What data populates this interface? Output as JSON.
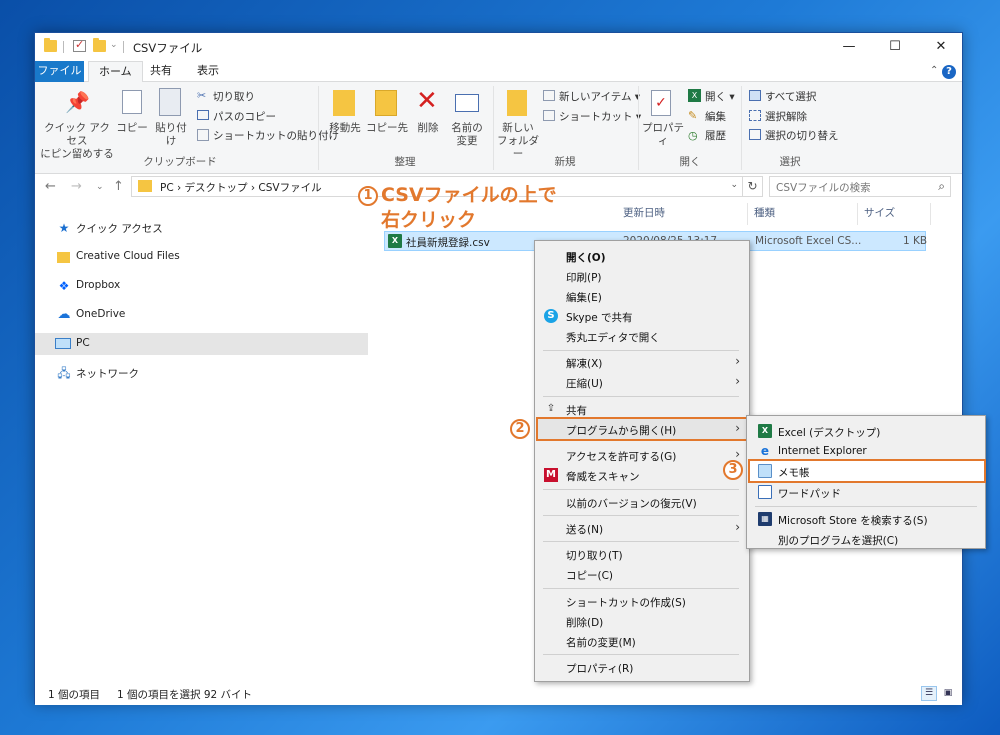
{
  "window": {
    "title": "CSVファイル",
    "minimize": "—",
    "maximize": "☐",
    "close": "✕"
  },
  "ribbon_tabs": [
    "ファイル",
    "ホーム",
    "共有",
    "表示"
  ],
  "ribbon": {
    "clipboard": {
      "label": "クリップボード",
      "pin": "クイック アクセス\nにピン留めする",
      "pin_l1": "クイック アクセス",
      "pin_l2": "にピン留めする",
      "copy": "コピー",
      "paste": "貼り付け",
      "cut": "切り取り",
      "copy_path": "パスのコピー",
      "paste_shortcut": "ショートカットの貼り付け"
    },
    "organize": {
      "label": "整理",
      "move_to": "移動先",
      "copy_to": "コピー先",
      "delete": "削除",
      "rename_l1": "名前の",
      "rename_l2": "変更"
    },
    "new": {
      "label": "新規",
      "new_folder_l1": "新しい",
      "new_folder_l2": "フォルダー",
      "new_item": "新しいアイテム",
      "shortcut": "ショートカット"
    },
    "open": {
      "label": "開く",
      "properties": "プロパティ",
      "open": "開く",
      "edit": "編集",
      "history": "履歴"
    },
    "select": {
      "label": "選択",
      "select_all": "すべて選択",
      "select_none": "選択解除",
      "invert": "選択の切り替え"
    }
  },
  "address": {
    "path": "PC  ›  デスクトップ  ›  CSVファイル",
    "search_placeholder": "CSVファイルの検索"
  },
  "sidebar": {
    "items": [
      {
        "label": "クイック アクセス",
        "icon": "star-icon"
      },
      {
        "label": "Creative Cloud Files",
        "icon": "creative-cloud-icon"
      },
      {
        "label": "Dropbox",
        "icon": "dropbox-icon"
      },
      {
        "label": "OneDrive",
        "icon": "cloud-icon"
      },
      {
        "label": "PC",
        "icon": "pc-icon"
      },
      {
        "label": "ネットワーク",
        "icon": "network-icon"
      }
    ]
  },
  "columns": {
    "date": "更新日時",
    "type": "種類",
    "size": "サイズ"
  },
  "file": {
    "name": "社員新規登録.csv",
    "date": "2020/08/25 13:17",
    "type": "Microsoft Excel CS...",
    "size": "1 KB"
  },
  "status": {
    "count": "1 個の項目",
    "selected": "1 個の項目を選択  92 バイト"
  },
  "context_menu": {
    "items": [
      "開く(O)",
      "印刷(P)",
      "編集(E)",
      "Skype で共有",
      "秀丸エディタで開く",
      "解凍(X)",
      "圧縮(U)",
      "共有",
      "プログラムから開く(H)",
      "アクセスを許可する(G)",
      "脅威をスキャン",
      "以前のバージョンの復元(V)",
      "送る(N)",
      "切り取り(T)",
      "コピー(C)",
      "ショートカットの作成(S)",
      "削除(D)",
      "名前の変更(M)",
      "プロパティ(R)"
    ]
  },
  "submenu": {
    "items": [
      "Excel (デスクトップ)",
      "Internet Explorer",
      "メモ帳",
      "ワードパッド",
      "Microsoft Store を検索する(S)",
      "別のプログラムを選択(C)"
    ]
  },
  "annotations": {
    "step1_num": "1",
    "step1_line1": "CSVファイルの上で",
    "step1_line2": "右クリック",
    "step2_num": "2",
    "step3_num": "3"
  },
  "colors": {
    "accent": "#e2782d",
    "selection": "#cce8ff",
    "file_tab": "#1979ca"
  }
}
